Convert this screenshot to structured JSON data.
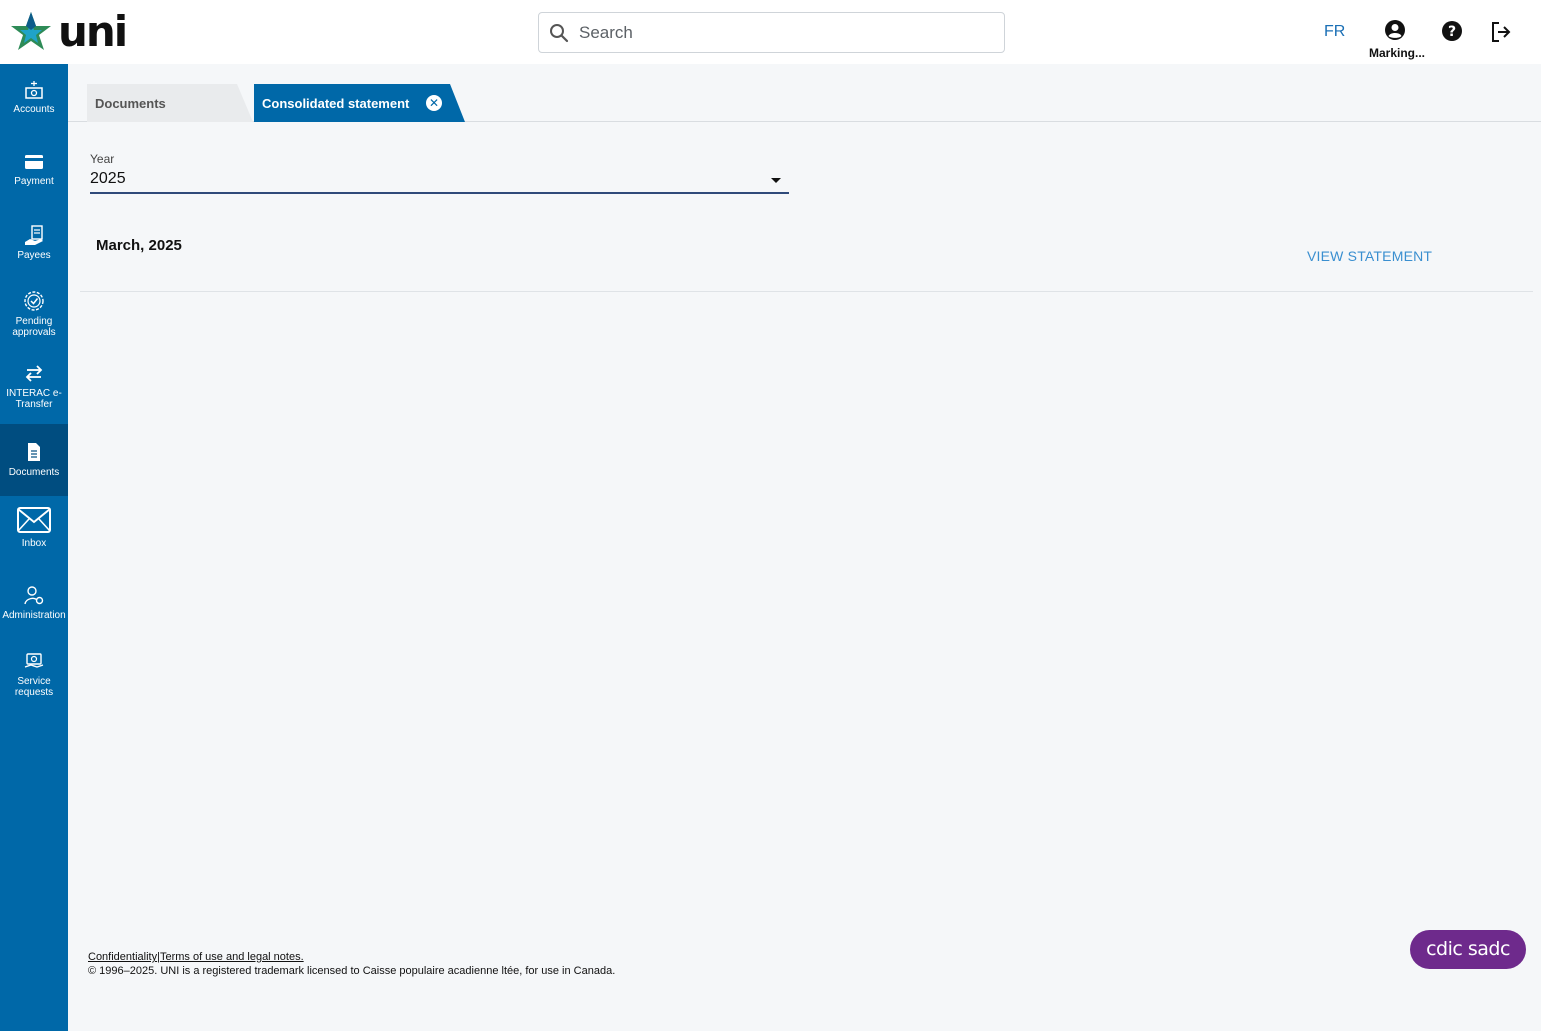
{
  "header": {
    "logo_text": "uni",
    "search_placeholder": "Search",
    "language": "FR",
    "user_name": "Marking...",
    "icons": [
      "search-icon",
      "account-circle-icon",
      "help-icon",
      "logout-icon"
    ]
  },
  "sidebar": {
    "items": [
      {
        "label": "Accounts",
        "icon": "accounts-icon"
      },
      {
        "label": "Payment",
        "icon": "card-icon"
      },
      {
        "label": "Payees",
        "icon": "payees-icon"
      },
      {
        "label": "Pending approvals",
        "icon": "approval-icon"
      },
      {
        "label": "INTERAC e-Transfer",
        "icon": "transfer-icon"
      },
      {
        "label": "Documents",
        "icon": "document-icon",
        "active": true
      },
      {
        "label": "Inbox",
        "icon": "mail-icon"
      },
      {
        "label": "Administration",
        "icon": "admin-icon"
      },
      {
        "label": "Service requests",
        "icon": "service-icon"
      }
    ],
    "color": "#0068a8",
    "active_color": "#004d80"
  },
  "tabs": [
    {
      "label": "Documents",
      "active": false
    },
    {
      "label": "Consolidated statement",
      "active": true
    }
  ],
  "filter": {
    "year_label": "Year",
    "year_value": "2025"
  },
  "statements": [
    {
      "period": "March, 2025",
      "action": "VIEW STATEMENT"
    }
  ],
  "footer": {
    "confidentiality": "Confidentiality",
    "separator": "|",
    "terms": "Terms of use and legal notes.",
    "copyright": "© 1996–2025. UNI is a registered trademark licensed to Caisse populaire acadienne ltée, for use in Canada.",
    "badge": "cdic sadc"
  }
}
